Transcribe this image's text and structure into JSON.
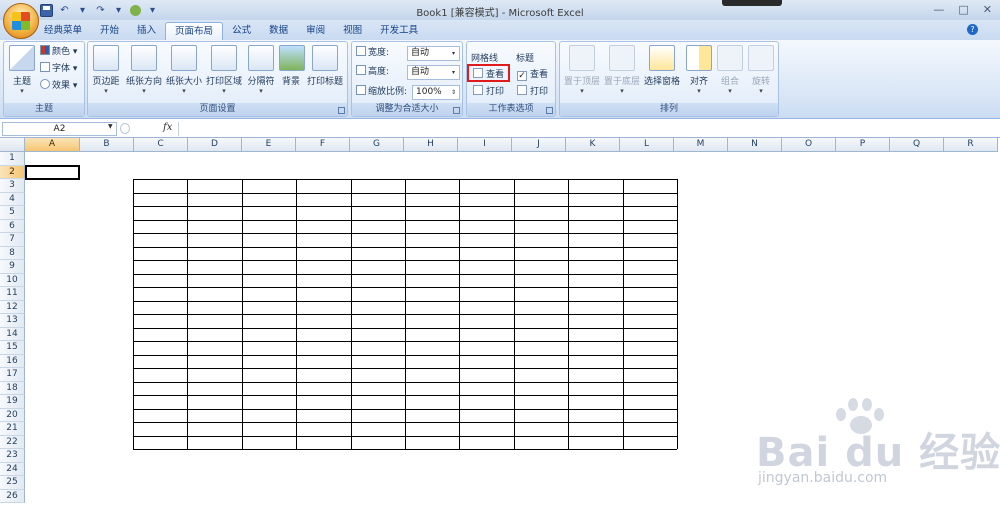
{
  "window": {
    "title": "Book1  [兼容模式] - Microsoft Excel",
    "controls": [
      "—",
      "□",
      "✕"
    ]
  },
  "qat": {
    "icons": [
      "save-icon",
      "undo-icon",
      "redo-icon",
      "print-preview-icon",
      "customize-qat-icon"
    ],
    "undo_glyph": "↶",
    "redo_glyph": "↷",
    "dropdown_glyph": "▾"
  },
  "tabs": [
    "经典菜单",
    "开始",
    "插入",
    "页面布局",
    "公式",
    "数据",
    "审阅",
    "视图",
    "开发工具"
  ],
  "active_tab": "页面布局",
  "help_glyph": "?",
  "ribbon": {
    "theme_group": {
      "label": "主题",
      "big_button": "主题",
      "items": [
        "颜色",
        "字体",
        "效果"
      ]
    },
    "page_setup_group": {
      "label": "页面设置",
      "buttons": [
        "页边距",
        "纸张方向",
        "纸张大小",
        "打印区域",
        "分隔符",
        "背景",
        "打印标题"
      ]
    },
    "scale_group": {
      "label": "调整为合适大小",
      "width_label": "宽度:",
      "width_value": "自动",
      "height_label": "高度:",
      "height_value": "自动",
      "scale_label": "缩放比例:",
      "scale_value": "100%"
    },
    "sheet_options_group": {
      "label": "工作表选项",
      "gridlines_title": "网格线",
      "gridlines_view": "查看",
      "gridlines_view_checked": false,
      "gridlines_print": "打印",
      "gridlines_print_checked": false,
      "headings_title": "标题",
      "headings_view": "查看",
      "headings_view_checked": true,
      "headings_print": "打印",
      "headings_print_checked": false
    },
    "arrange_group": {
      "label": "排列",
      "buttons": [
        "置于顶层",
        "置于底层",
        "选择窗格",
        "对齐",
        "组合",
        "旋转"
      ]
    }
  },
  "formula_bar": {
    "name_box": "A2",
    "fx": "fx",
    "formula": ""
  },
  "sheet": {
    "columns": [
      "A",
      "B",
      "C",
      "D",
      "E",
      "F",
      "G",
      "H",
      "I",
      "J",
      "K",
      "L",
      "M",
      "N",
      "O",
      "P",
      "Q",
      "R"
    ],
    "rows": [
      "1",
      "2",
      "3",
      "4",
      "5",
      "6",
      "7",
      "8",
      "9",
      "10",
      "11",
      "12",
      "13",
      "14",
      "15",
      "16",
      "17",
      "18",
      "19",
      "20",
      "21",
      "22",
      "23",
      "24",
      "25",
      "26"
    ],
    "selected_column": "A",
    "selected_row": "2",
    "active_cell": "A2",
    "bordered_range": "C3:L22"
  },
  "watermark": {
    "brand": "Bai du 经验",
    "url": "jingyan.baidu.com"
  },
  "colors": {
    "highlight_box": "#e01b1b",
    "ribbon_blue": "#cbdcf2",
    "selected_header": "#f5c572"
  }
}
